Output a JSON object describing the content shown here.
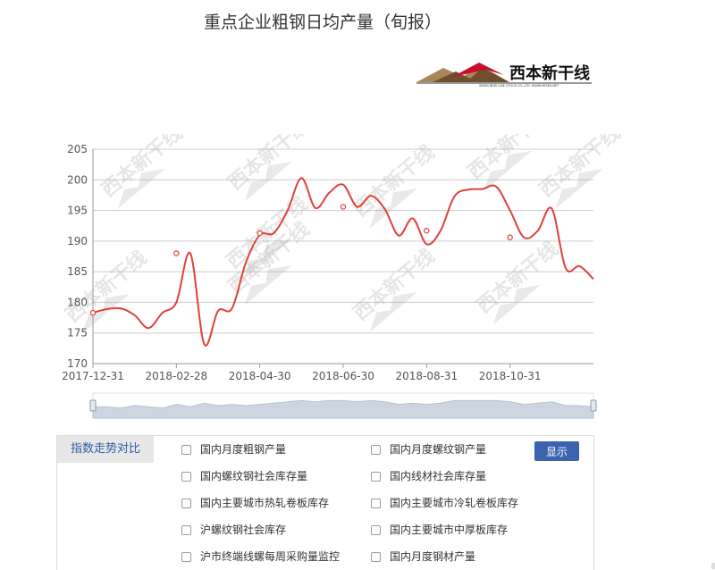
{
  "title": "重点企业粗钢日均产量（旬报）",
  "logo": {
    "text": "西本新干线",
    "subtext": "XIBEN NEW LINE STOCK CO.,LTD.  WWW.96369.NET"
  },
  "watermark": {
    "text": "西本新干线"
  },
  "colors": {
    "line": "#e0403a",
    "grid": "#cccccc",
    "axis": "#999999",
    "slider_fill": "#cdd5e1",
    "button": "#3b63b0"
  },
  "chart_data": {
    "type": "line",
    "title": "",
    "xlabel": "",
    "ylabel": "",
    "ylim": [
      170,
      205
    ],
    "yticks": [
      170,
      175,
      180,
      185,
      190,
      195,
      200,
      205
    ],
    "xtick_labels": [
      "2017-12-31",
      "2018-02-28",
      "2018-04-30",
      "2018-06-30",
      "2018-08-31",
      "2018-10-31"
    ],
    "grid": true,
    "series": [
      {
        "values": [
          178.3,
          178.9,
          179.0,
          177.9,
          175.8,
          178.3,
          180.0,
          188.0,
          173.2,
          178.6,
          179.0,
          186.5,
          191.0,
          191.3,
          195.0,
          200.3,
          195.4,
          197.9,
          199.2,
          195.6,
          197.4,
          195.2,
          190.9,
          193.7,
          189.5,
          191.7,
          197.3,
          198.4,
          198.5,
          198.9,
          195.0,
          190.6,
          191.7,
          195.3,
          185.6,
          185.9,
          183.8
        ],
        "markers": [
          {
            "x": "2017-12-31",
            "y": 178.3
          },
          {
            "x": "2018-02-28",
            "y": 188.0
          },
          {
            "x": "2018-04-30",
            "y": 191.3
          },
          {
            "x": "2018-06-30",
            "y": 195.6
          },
          {
            "x": "2018-08-31",
            "y": 191.7
          },
          {
            "x": "2018-10-31",
            "y": 190.6
          }
        ]
      }
    ]
  },
  "panel": {
    "title": "指数走势对比",
    "button": "显示",
    "options": [
      "国内月度粗钢产量",
      "国内月度螺纹钢产量",
      "国内螺纹钢社会库存量",
      "国内线材社会库存量",
      "国内主要城市热轧卷板库存",
      "国内主要城市冷轧卷板库存",
      "沪螺纹钢社会库存",
      "国内主要城市中厚板库存",
      "沪市终端线螺每周采购量监控",
      "国内月度钢材产量"
    ]
  }
}
